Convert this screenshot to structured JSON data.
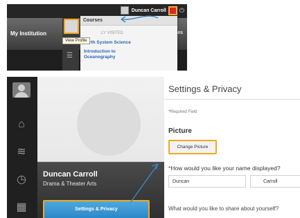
{
  "top_panel": {
    "user_name": "Duncan Carroll",
    "institution_tab": "My Institution",
    "right_tab_partial": "ces",
    "courses_menu": {
      "header": "Courses",
      "recently_visited": "LY VISITED",
      "items": [
        "Earth System Science",
        "Introduction to",
        "Oceanography"
      ]
    },
    "tooltip": "View Profile"
  },
  "bottom_panel": {
    "profile": {
      "name": "Duncan Carroll",
      "department": "Drama & Theater Arts",
      "settings_button": "Settings & Privacy"
    },
    "settings": {
      "title": "Settings & Privacy",
      "required_star": "*",
      "required_text": "Required Field",
      "picture_label": "Picture",
      "change_picture_button": "Change Picture",
      "name_star": "*",
      "name_question": "How would you like your name displayed?",
      "first_name_value": "Duncan",
      "last_name_value": "Carroll",
      "share_question": "What would you like to share about yourself?"
    }
  },
  "colors": {
    "highlight": "#f3a81b",
    "arrow": "#3a86c8",
    "link": "#2a65b5",
    "button_blue": "#2b88c9"
  }
}
